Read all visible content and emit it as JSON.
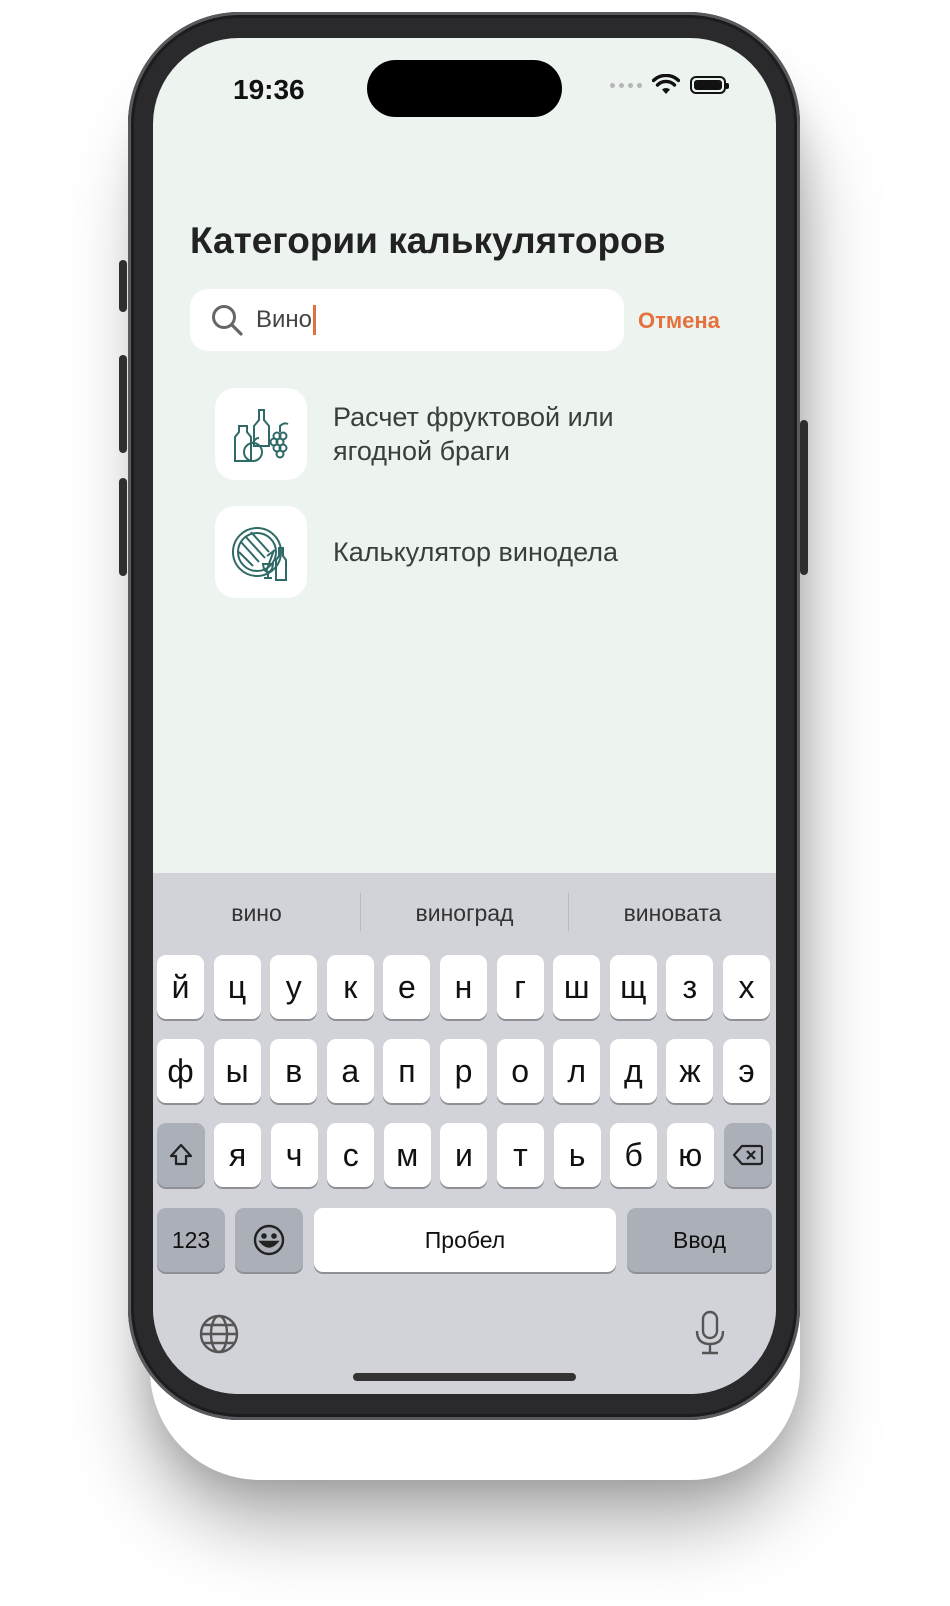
{
  "status_bar": {
    "time": "19:36"
  },
  "page": {
    "title": "Категории калькуляторов"
  },
  "search": {
    "value": "Вино",
    "cancel_label": "Отмена"
  },
  "results": [
    {
      "label": "Расчет фруктовой или ягодной браги",
      "icon": "fruit-wine-icon"
    },
    {
      "label": "Калькулятор винодела",
      "icon": "winemaker-icon"
    }
  ],
  "keyboard": {
    "suggestions": [
      "вино",
      "виноград",
      "виновата"
    ],
    "row1": [
      "й",
      "ц",
      "у",
      "к",
      "е",
      "н",
      "г",
      "ш",
      "щ",
      "з",
      "х"
    ],
    "row2": [
      "ф",
      "ы",
      "в",
      "а",
      "п",
      "р",
      "о",
      "л",
      "д",
      "ж",
      "э"
    ],
    "row3": [
      "я",
      "ч",
      "с",
      "м",
      "и",
      "т",
      "ь",
      "б",
      "ю"
    ],
    "numbers_label": "123",
    "space_label": "Пробел",
    "return_label": "Ввод"
  },
  "colors": {
    "background": "#edf3ef",
    "accent": "#e4713e",
    "icon": "#2f6a67"
  }
}
